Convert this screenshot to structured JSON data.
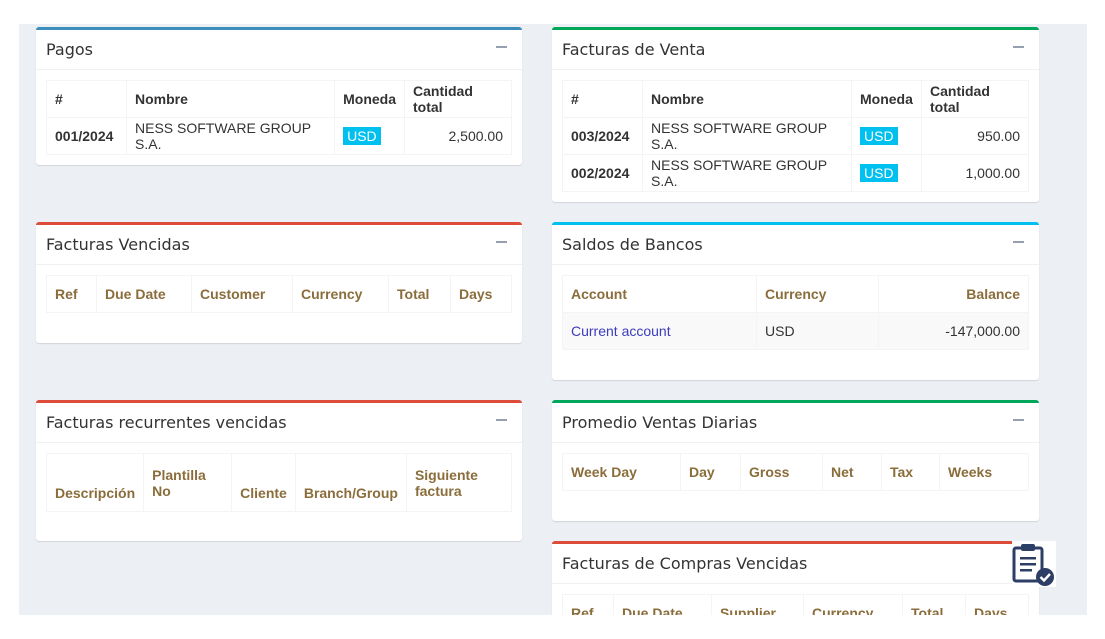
{
  "pagos": {
    "title": "Pagos",
    "headers": [
      "#",
      "Nombre",
      "Moneda",
      "Cantidad total"
    ],
    "rows": [
      [
        "001/2024",
        "NESS SOFTWARE GROUP S.A.",
        "USD",
        "2,500.00"
      ]
    ]
  },
  "facturas_venta": {
    "title": "Facturas de Venta",
    "headers": [
      "#",
      "Nombre",
      "Moneda",
      "Cantidad total"
    ],
    "rows": [
      [
        "003/2024",
        "NESS SOFTWARE GROUP S.A.",
        "USD",
        "950.00"
      ],
      [
        "002/2024",
        "NESS SOFTWARE GROUP S.A.",
        "USD",
        "1,000.00"
      ]
    ]
  },
  "facturas_vencidas": {
    "title": "Facturas Vencidas",
    "headers": [
      "Ref",
      "Due Date",
      "Customer",
      "Currency",
      "Total",
      "Days"
    ]
  },
  "saldos_bancos": {
    "title": "Saldos de Bancos",
    "headers": [
      "Account",
      "Currency",
      "Balance"
    ],
    "rows": [
      [
        "Current account",
        "USD",
        "-147,000.00"
      ]
    ]
  },
  "recurrentes": {
    "title": "Facturas recurrentes vencidas",
    "headers": [
      "Descripción",
      "Plantilla No",
      "Cliente",
      "Branch/Group",
      "Siguiente factura"
    ]
  },
  "promedio": {
    "title": "Promedio Ventas Diarias",
    "headers": [
      "Week Day",
      "Day",
      "Gross",
      "Net",
      "Tax",
      "Weeks"
    ]
  },
  "compras_vencidas": {
    "title": "Facturas de Compras Vencidas",
    "headers": [
      "Ref",
      "Due Date",
      "Supplier",
      "Currency",
      "Total",
      "Days"
    ]
  },
  "icons": {
    "collapse": "minus-icon",
    "clipboard": "clipboard-check-icon"
  },
  "colors": {
    "blue": "#3c8dbc",
    "green": "#00a65a",
    "red": "#dd4b39",
    "cyan": "#00c0ef",
    "gold": "#8a6d3b"
  }
}
